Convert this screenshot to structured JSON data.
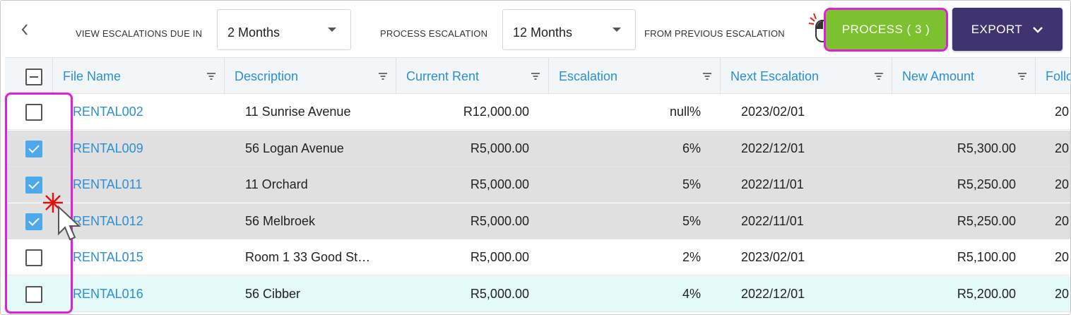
{
  "toolbar": {
    "view_label": "VIEW ESCALATIONS DUE IN",
    "view_value": "2 Months",
    "process_label": "PROCESS ESCALATION",
    "process_value": "12 Months",
    "from_label": "FROM PREVIOUS ESCALATION",
    "process_button": "PROCESS ( 3 )",
    "export_button": "EXPORT"
  },
  "columns": [
    "File Name",
    "Description",
    "Current Rent",
    "Escalation",
    "Next Escalation",
    "New Amount",
    "Follo"
  ],
  "rows": [
    {
      "file": "RENTAL002",
      "desc": "11 Sunrise Avenue",
      "rent": "R12,000.00",
      "esc": "null%",
      "next": "2023/02/01",
      "amount": "",
      "follow": "20",
      "checked": false
    },
    {
      "file": "RENTAL009",
      "desc": "56 Logan Avenue",
      "rent": "R5,000.00",
      "esc": "6%",
      "next": "2022/12/01",
      "amount": "R5,300.00",
      "follow": "20",
      "checked": true
    },
    {
      "file": "RENTAL011",
      "desc": "11 Orchard",
      "rent": "R5,000.00",
      "esc": "5%",
      "next": "2022/11/01",
      "amount": "R5,250.00",
      "follow": "20",
      "checked": true
    },
    {
      "file": "RENTAL012",
      "desc": "56 Melbroek",
      "rent": "R5,000.00",
      "esc": "5%",
      "next": "2022/11/01",
      "amount": "R5,250.00",
      "follow": "20",
      "checked": true
    },
    {
      "file": "RENTAL015",
      "desc": "Room 1 33 Good St…",
      "rent": "R5,000.00",
      "esc": "2%",
      "next": "2023/02/01",
      "amount": "R5,100.00",
      "follow": "20",
      "checked": false
    },
    {
      "file": "RENTAL016",
      "desc": "56 Cibber",
      "rent": "R5,000.00",
      "esc": "4%",
      "next": "2022/12/01",
      "amount": "R5,200.00",
      "follow": "20",
      "checked": false
    }
  ],
  "colors": {
    "accent_link": "#2b8fd6",
    "process_green": "#7cc22e",
    "export_purple": "#3f3470",
    "highlight_magenta": "#e020d8",
    "checkbox_blue": "#4da9ee"
  },
  "icons": [
    "chevron-left-icon",
    "caret-down-icon",
    "filter-icon",
    "chevron-down-icon",
    "mouse-click-icon",
    "cursor-arrow-icon"
  ]
}
